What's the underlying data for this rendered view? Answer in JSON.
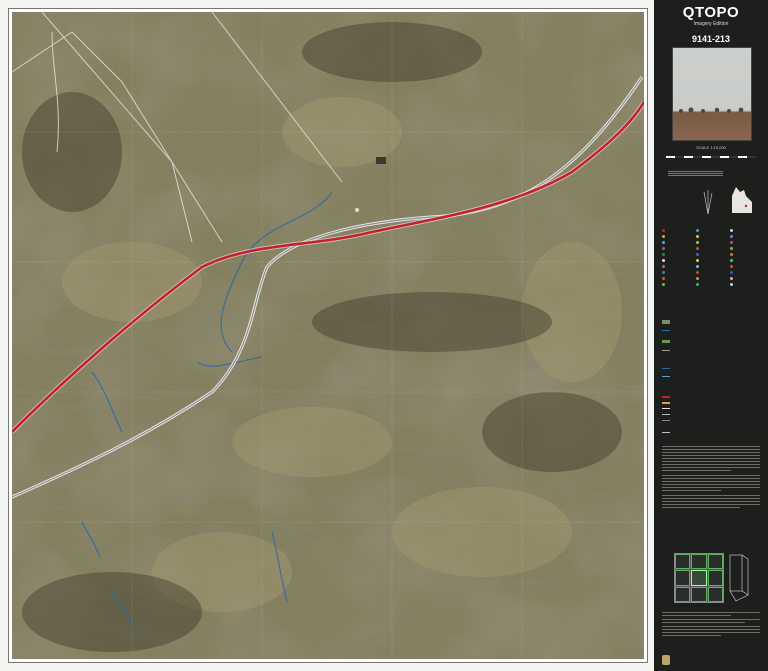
{
  "panel": {
    "title": "QTOPO",
    "edition": "Imagery Edition",
    "sheet_number": "9141-213",
    "scale": "SCALE 1:10,000"
  },
  "map": {
    "description_hidden": "",
    "colors": {
      "highway": "#c0222e",
      "road": "#e6e6e6",
      "waterway": "#2a6aa8",
      "vegetation": "#5a6a3a",
      "terrain": "#8a7a5a"
    }
  }
}
